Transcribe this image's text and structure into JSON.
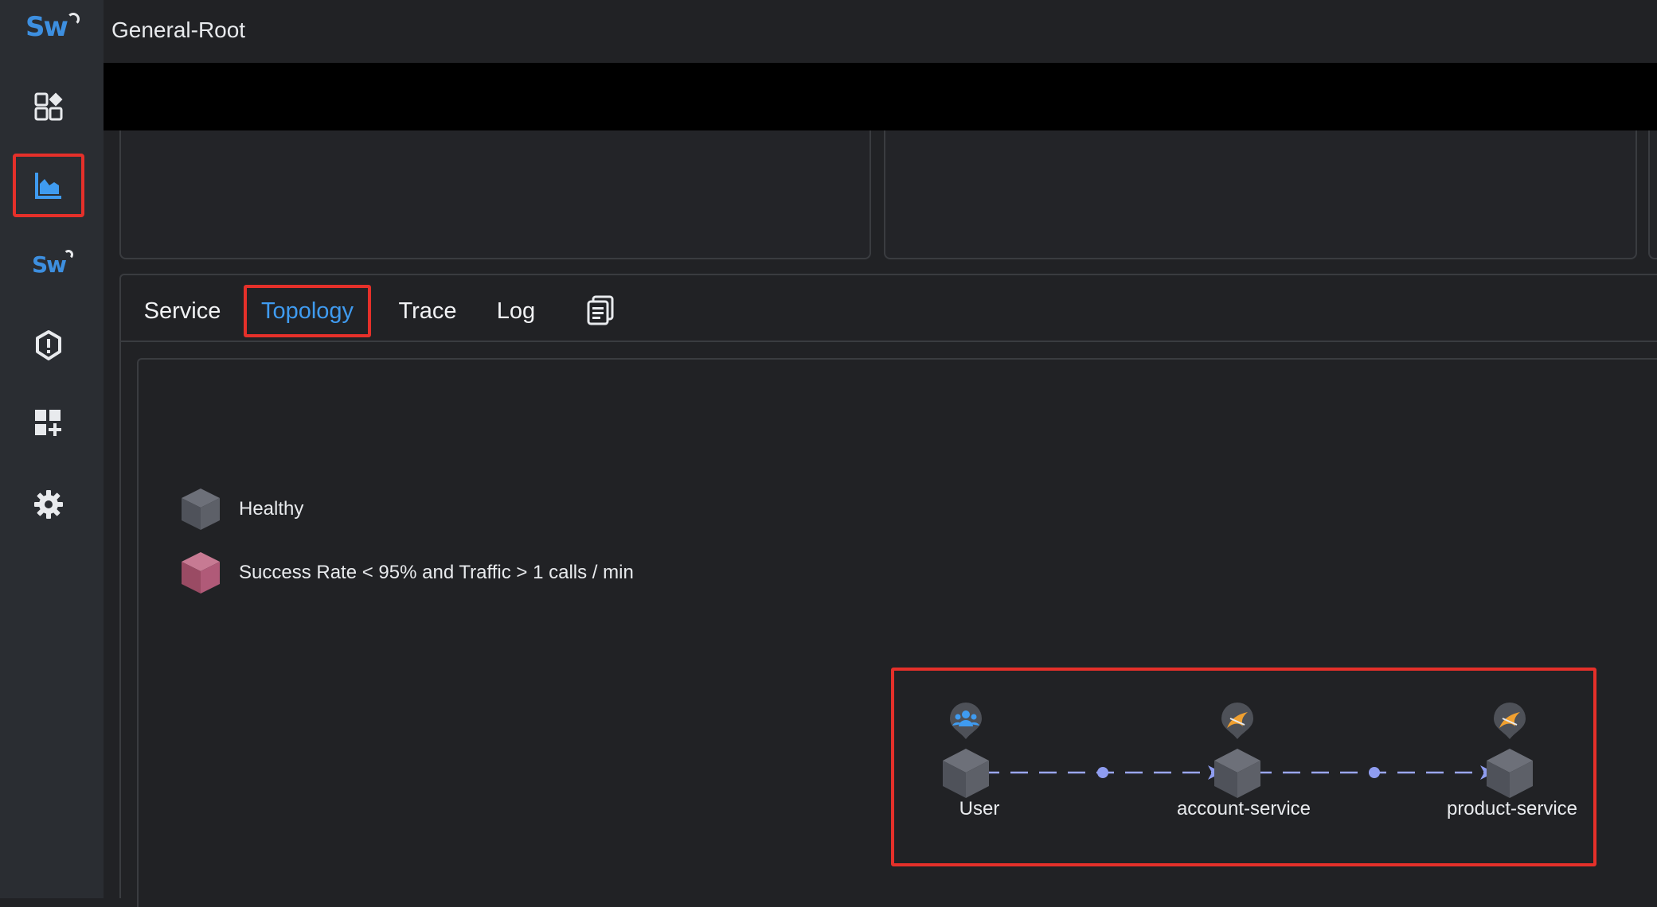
{
  "app": {
    "logo_text": "Sw",
    "title": "General-Root"
  },
  "sidebar": {
    "items": [
      {
        "name": "dashboard-icon"
      },
      {
        "name": "chart-icon",
        "active": true
      },
      {
        "name": "skywalking-icon",
        "label": "Sw"
      },
      {
        "name": "alert-shield-icon"
      },
      {
        "name": "add-widget-icon"
      },
      {
        "name": "settings-gear-icon"
      }
    ]
  },
  "tabs": [
    {
      "label": "Service"
    },
    {
      "label": "Topology",
      "active": true
    },
    {
      "label": "Trace"
    },
    {
      "label": "Log"
    }
  ],
  "legend": {
    "healthy": "Healthy",
    "unhealthy": "Success Rate < 95% and Traffic > 1 calls / min"
  },
  "topology": {
    "nodes": [
      {
        "label": "User",
        "type": "user"
      },
      {
        "label": "account-service",
        "type": "service"
      },
      {
        "label": "product-service",
        "type": "service"
      }
    ]
  },
  "colors": {
    "accent": "#3f9bf0",
    "highlight": "#e5302a",
    "healthy_node": "#5b5e66",
    "unhealthy_node": "#b05a78",
    "edge": "#8f9df0",
    "service_badge": "#f0a030"
  }
}
